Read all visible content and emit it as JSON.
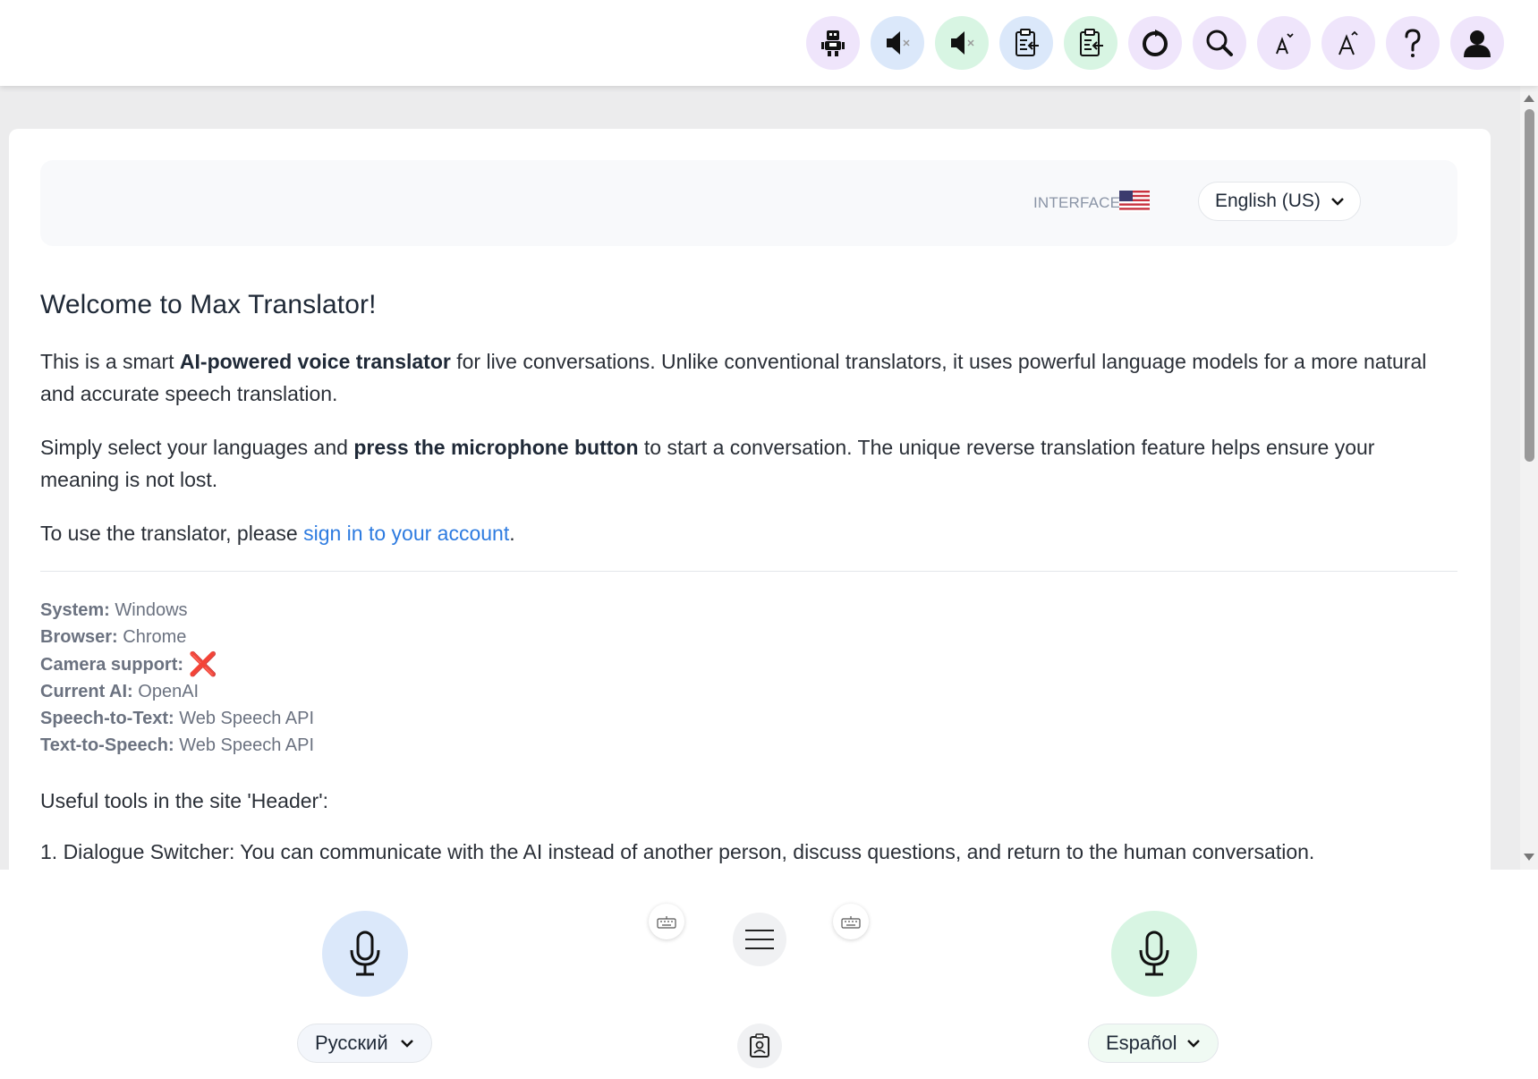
{
  "header": {
    "tools": [
      {
        "name": "dialogue-switcher",
        "icon": "robot-icon",
        "bg": "#efe5fb"
      },
      {
        "name": "mute-left",
        "icon": "speaker-muted-icon",
        "bg": "#dbe8fa"
      },
      {
        "name": "mute-right",
        "icon": "speaker-muted-icon",
        "bg": "#d8f5e3"
      },
      {
        "name": "clipboard-left",
        "icon": "clipboard-icon",
        "bg": "#dbe8fa"
      },
      {
        "name": "clipboard-right",
        "icon": "clipboard-icon",
        "bg": "#d8f5e3"
      },
      {
        "name": "reset",
        "icon": "refresh-icon",
        "bg": "#efe5fb"
      },
      {
        "name": "search",
        "icon": "search-icon",
        "bg": "#efe5fb"
      },
      {
        "name": "font-decrease",
        "icon": "font-decrease-icon",
        "bg": "#efe5fb"
      },
      {
        "name": "font-increase",
        "icon": "font-increase-icon",
        "bg": "#efe5fb"
      },
      {
        "name": "help",
        "icon": "question-icon",
        "bg": "#efe5fb"
      },
      {
        "name": "account",
        "icon": "user-icon",
        "bg": "#efe5fb"
      }
    ]
  },
  "interface": {
    "label": "INTERFACE",
    "flag_icon": "us-flag-icon",
    "selected": "English (US)"
  },
  "welcome": {
    "title": "Welcome to Max Translator!",
    "p1_a": "This is a smart ",
    "p1_b": "AI-powered voice translator",
    "p1_c": " for live conversations. Unlike conventional translators, it uses powerful language models for a more natural and accurate speech translation.",
    "p2_a": "Simply select your languages and ",
    "p2_b": "press the microphone button",
    "p2_c": " to start a conversation. The unique reverse translation feature helps ensure your meaning is not lost.",
    "p3_a": "To use the translator, please ",
    "p3_link": "sign in to your account",
    "p3_c": "."
  },
  "system_info": [
    {
      "key": "System:",
      "value": "Windows"
    },
    {
      "key": "Browser:",
      "value": "Chrome"
    },
    {
      "key": "Camera support:",
      "value": "❌"
    },
    {
      "key": "Current AI:",
      "value": "OpenAI"
    },
    {
      "key": "Speech-to-Text:",
      "value": "Web Speech API"
    },
    {
      "key": "Text-to-Speech:",
      "value": "Web Speech API"
    }
  ],
  "tools_section": {
    "title": "Useful tools in the site 'Header':",
    "item1": "1. Dialogue Switcher: You can communicate with the AI instead of another person, discuss questions, and return to the human conversation."
  },
  "bottom": {
    "left_language": "Русский",
    "right_language": "Español",
    "left_mic_bg": "#dbe8fa",
    "right_mic_bg": "#d8f5e3"
  },
  "colors": {
    "link": "#2d7be0",
    "error_mark": "#e8456b"
  }
}
